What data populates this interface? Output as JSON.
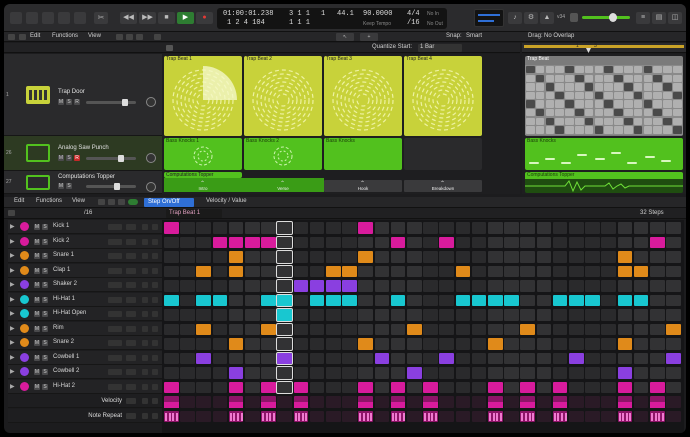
{
  "transport": {
    "position_time": "01:00:01.238",
    "position_bars": "1 2 4 104",
    "bar_beat_top": "3 1 1",
    "bar_beat_bottom": "1 1 1",
    "beat_sub": "1",
    "tempo_small": "44.1",
    "tempo": "90.0000",
    "tempo_mode": "Keep Tempo",
    "signature": "4/4",
    "division": "/16",
    "midi_in": "No In",
    "midi_out": "No Out",
    "cpu_label": "v34"
  },
  "tracks_header": {
    "edit": "Edit",
    "functions": "Functions",
    "view": "View",
    "snap_label": "Snap:",
    "snap_value": "Smart",
    "drag_label": "Drag:",
    "drag_value": "No Overlap",
    "quantize_label": "Quantize Start:",
    "quantize_value": "1 Bar",
    "ruler_1": "1",
    "ruler_3": "3"
  },
  "tracks": [
    {
      "num": "1",
      "name": "Trap Door"
    },
    {
      "num": "26",
      "name": "Analog Saw Punch"
    },
    {
      "num": "27",
      "name": "Computations Topper"
    }
  ],
  "cells": {
    "trap_beats": [
      "Trap Beat 1",
      "Trap Beat 2",
      "Trap Beat 3",
      "Trap Beat 4"
    ],
    "bass": [
      "Bass Knocks 1",
      "Bass Knocks 2",
      "Bass Knocks"
    ],
    "topper": "Computations Topper"
  },
  "regions": {
    "trap": "Trap Beat",
    "bass": "Bass Knocks",
    "topper": "Computations Topper"
  },
  "scenes": [
    "Intro",
    "Verse",
    "Hook",
    "Breakdown"
  ],
  "step_header": {
    "edit": "Edit",
    "functions": "Functions",
    "view": "View",
    "division": "/16",
    "mode_tab": "Step On/Off",
    "mode_tab2": "Velocity / Value",
    "pattern_name": "Trap Beat 1",
    "steps": "32 Steps"
  },
  "step_rows": [
    {
      "name": "Kick 1",
      "color": "#d81b9c",
      "steps": [
        1,
        0,
        0,
        0,
        0,
        0,
        0,
        0,
        0,
        0,
        0,
        0,
        1,
        0,
        0,
        0,
        0,
        0,
        0,
        0,
        0,
        0,
        0,
        0,
        0,
        0,
        0,
        0,
        0,
        0,
        0,
        0
      ]
    },
    {
      "name": "Kick 2",
      "color": "#d81b9c",
      "steps": [
        0,
        0,
        0,
        1,
        1,
        1,
        1,
        0,
        0,
        0,
        0,
        0,
        0,
        0,
        1,
        0,
        0,
        1,
        0,
        0,
        0,
        0,
        0,
        0,
        0,
        0,
        0,
        0,
        0,
        0,
        1,
        0
      ]
    },
    {
      "name": "Snare 1",
      "color": "#e08a1a",
      "steps": [
        0,
        0,
        0,
        0,
        1,
        0,
        0,
        0,
        0,
        0,
        0,
        0,
        1,
        0,
        0,
        0,
        0,
        0,
        0,
        0,
        0,
        0,
        0,
        0,
        0,
        0,
        0,
        0,
        1,
        0,
        0,
        0
      ]
    },
    {
      "name": "Clap 1",
      "color": "#e08a1a",
      "steps": [
        0,
        0,
        1,
        0,
        1,
        0,
        0,
        0,
        0,
        0,
        1,
        1,
        0,
        0,
        0,
        0,
        0,
        0,
        1,
        0,
        0,
        0,
        0,
        0,
        0,
        0,
        0,
        0,
        1,
        1,
        0,
        0
      ]
    },
    {
      "name": "Shaker 2",
      "color": "#8a3fe0",
      "steps": [
        0,
        0,
        0,
        0,
        0,
        0,
        0,
        0,
        1,
        1,
        1,
        1,
        0,
        0,
        0,
        0,
        0,
        0,
        0,
        0,
        0,
        0,
        0,
        0,
        0,
        0,
        0,
        0,
        0,
        0,
        0,
        0
      ]
    },
    {
      "name": "Hi-Hat 1",
      "color": "#18c7d0",
      "steps": [
        1,
        0,
        1,
        1,
        0,
        0,
        1,
        1,
        0,
        1,
        1,
        1,
        0,
        0,
        1,
        0,
        0,
        0,
        1,
        1,
        1,
        1,
        0,
        0,
        1,
        1,
        1,
        0,
        1,
        1,
        0,
        0
      ]
    },
    {
      "name": "Hi-Hat Open",
      "color": "#18c7d0",
      "steps": [
        0,
        0,
        0,
        0,
        0,
        0,
        0,
        1,
        0,
        0,
        0,
        0,
        0,
        0,
        0,
        0,
        0,
        0,
        0,
        0,
        0,
        0,
        0,
        0,
        0,
        0,
        0,
        0,
        0,
        0,
        0,
        0
      ]
    },
    {
      "name": "Rim",
      "color": "#e08a1a",
      "steps": [
        0,
        0,
        1,
        0,
        0,
        0,
        1,
        0,
        0,
        0,
        0,
        0,
        0,
        0,
        0,
        1,
        0,
        0,
        0,
        0,
        0,
        0,
        1,
        0,
        0,
        0,
        0,
        0,
        0,
        0,
        0,
        1
      ]
    },
    {
      "name": "Snare 2",
      "color": "#e08a1a",
      "steps": [
        0,
        0,
        0,
        0,
        1,
        0,
        0,
        0,
        0,
        0,
        0,
        0,
        1,
        0,
        0,
        0,
        0,
        0,
        0,
        0,
        1,
        0,
        0,
        0,
        0,
        0,
        0,
        0,
        1,
        0,
        0,
        0
      ]
    },
    {
      "name": "Cowbell 1",
      "color": "#8a3fe0",
      "steps": [
        0,
        0,
        1,
        0,
        0,
        0,
        0,
        1,
        0,
        0,
        0,
        0,
        0,
        1,
        0,
        0,
        0,
        1,
        0,
        0,
        0,
        0,
        0,
        0,
        0,
        1,
        0,
        0,
        0,
        0,
        0,
        1
      ]
    },
    {
      "name": "Cowbell 2",
      "color": "#8a3fe0",
      "steps": [
        0,
        0,
        0,
        0,
        1,
        0,
        0,
        0,
        0,
        0,
        0,
        0,
        0,
        0,
        0,
        1,
        0,
        0,
        0,
        0,
        0,
        0,
        0,
        0,
        0,
        0,
        0,
        0,
        1,
        0,
        0,
        0
      ]
    },
    {
      "name": "Hi-Hat 2",
      "color": "#d81b9c",
      "steps": [
        1,
        0,
        0,
        0,
        1,
        0,
        1,
        0,
        1,
        0,
        0,
        0,
        1,
        0,
        1,
        0,
        1,
        0,
        0,
        0,
        1,
        0,
        1,
        0,
        1,
        0,
        0,
        0,
        1,
        0,
        1,
        0
      ]
    }
  ],
  "param_rows": [
    {
      "name": "Velocity"
    },
    {
      "name": "Note Repeat"
    }
  ],
  "colors": {
    "yellow": "#c8d23a",
    "green": "#52c11e",
    "accent": "#e8c33a"
  }
}
